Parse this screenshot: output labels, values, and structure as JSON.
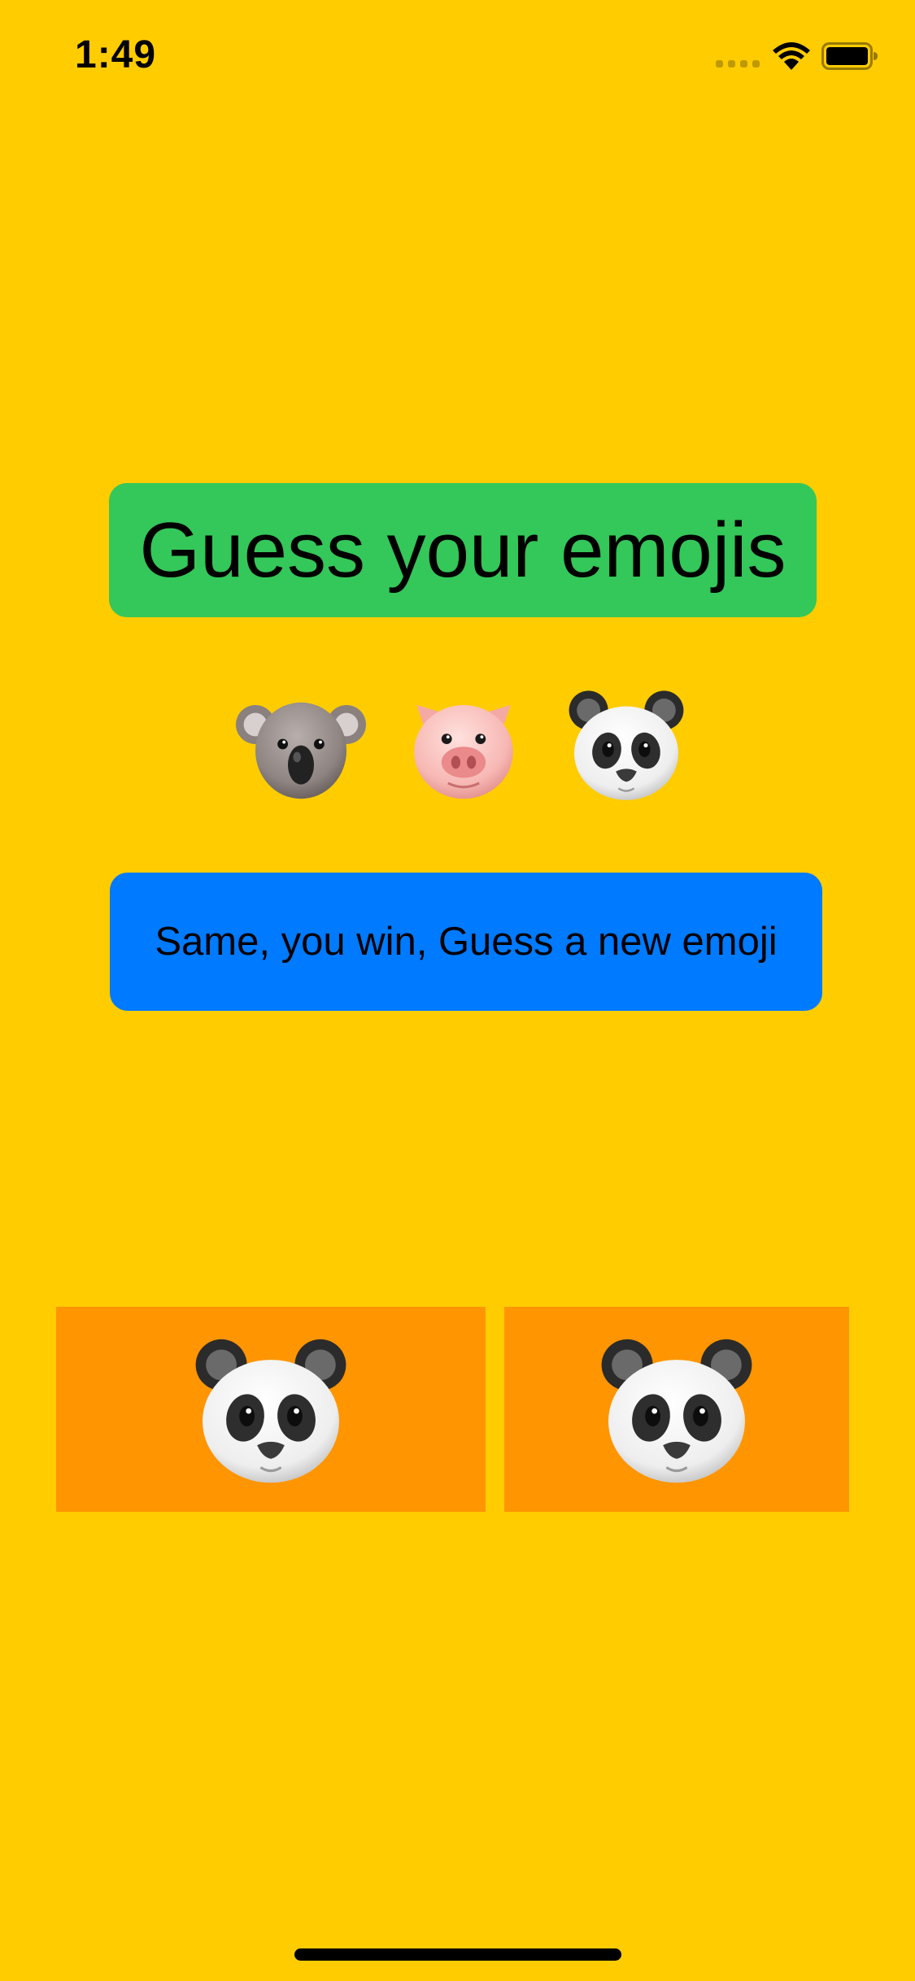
{
  "status_bar": {
    "time": "1:49"
  },
  "title": {
    "label": "Guess your emojis"
  },
  "emoji_row": [
    {
      "emoji": "koala"
    },
    {
      "emoji": "pig"
    },
    {
      "emoji": "panda"
    }
  ],
  "result": {
    "message": "Same, you win, Guess a new emoji"
  },
  "buttons": {
    "left": {
      "emoji": "panda"
    },
    "right": {
      "emoji": "panda"
    }
  },
  "colors": {
    "background": "#FFCC00",
    "title_bg": "#34C759",
    "result_bg": "#007AFF",
    "button_bg": "#FF9500"
  }
}
